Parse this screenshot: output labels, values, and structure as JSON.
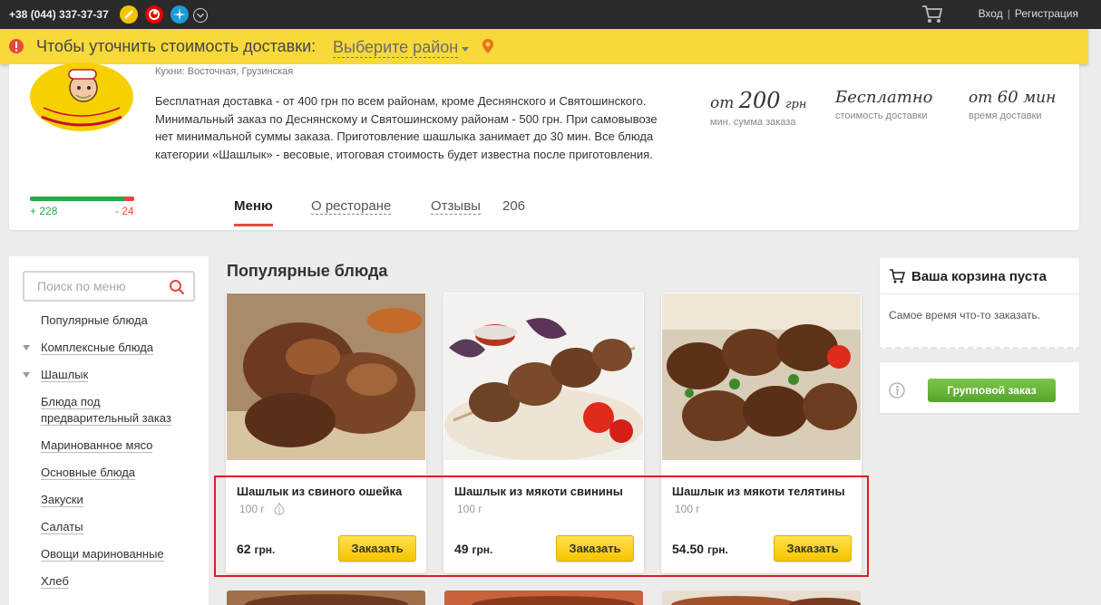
{
  "topbar": {
    "phone": "+38 (044) 337-37-37",
    "operators": [
      "lifecell-icon",
      "vodafone-icon",
      "kyivstar-icon",
      "more-phones-icon"
    ],
    "login": "Вход",
    "separator": "|",
    "register": "Регистрация"
  },
  "delivery": {
    "prompt": "Чтобы уточнить стоимость доставки:",
    "district_placeholder": "Выберите район"
  },
  "restaurant": {
    "cuisine": "Кухни: Восточная, Грузинская",
    "description": "Бесплатная доставка - от 400 грн по всем районам, кроме Деснянского и Святошинского. Минимальный заказ по Деснянскому и Святошинскому районам - 500 грн. При самовывозе нет минимальной суммы заказа. Приготовление шашлыка занимает до 30 мин. Все блюда категории «Шашлык» - весовые, итоговая стоимость будет известна после приготовления.",
    "rating_plus": "+ 228",
    "rating_minus": "- 24",
    "rating_positive_share": 0.905,
    "stats": {
      "min_order_prefix": "от",
      "min_order_value": "200",
      "min_order_unit": "грн",
      "min_order_label": "мин. сумма заказа",
      "delivery_cost": "Бесплатно",
      "delivery_cost_label": "стоимость доставки",
      "delivery_time_prefix": "от",
      "delivery_time_value": "60",
      "delivery_time_unit": "мин",
      "delivery_time_label": "время доставки"
    },
    "tabs": {
      "menu": "Меню",
      "about": "О ресторане",
      "reviews": "Отзывы",
      "reviews_count": "206"
    }
  },
  "sidebar": {
    "search_placeholder": "Поиск по меню",
    "items": [
      {
        "label": "Популярные блюда"
      },
      {
        "label": "Комплексные блюда"
      },
      {
        "label": "Шашлык"
      },
      {
        "label": "Блюда под предварительный заказ"
      },
      {
        "label": "Маринованное мясо"
      },
      {
        "label": "Основные блюда"
      },
      {
        "label": "Закуски"
      },
      {
        "label": "Салаты"
      },
      {
        "label": "Овощи маринованные"
      },
      {
        "label": "Хлеб"
      }
    ]
  },
  "main": {
    "section_title": "Популярные блюда",
    "dishes": [
      {
        "name": "Шашлык из свиного ошейка",
        "weight": "100 г",
        "price": "62",
        "currency": "грн.",
        "order": "Заказать"
      },
      {
        "name": "Шашлык из мякоти свинины",
        "weight": "100 г",
        "price": "49",
        "currency": "грн.",
        "order": "Заказать"
      },
      {
        "name": "Шашлык из мякоти телятины",
        "weight": "100 г",
        "price": "54.50",
        "currency": "грн.",
        "order": "Заказать"
      }
    ]
  },
  "basket": {
    "title": "Ваша корзина пуста",
    "text": "Самое время что-то заказать.",
    "group_order": "Групповой заказ"
  },
  "colors": {
    "accent_yellow": "#f8d93a",
    "accent_red": "#e34b3c",
    "positive_green": "#27a844",
    "group_button": "#55a52a"
  }
}
